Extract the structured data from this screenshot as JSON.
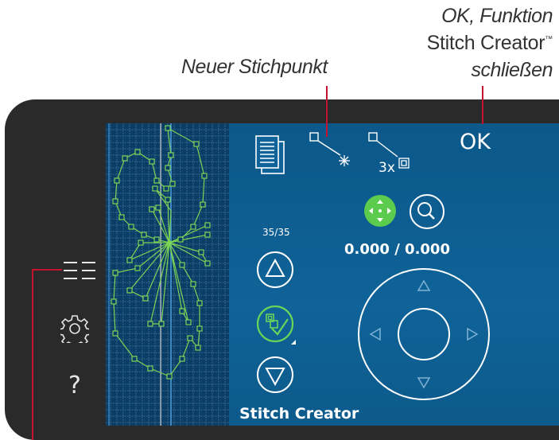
{
  "callouts": {
    "new_point": "Neuer Stichpunkt",
    "ok_line1": "OK, Funktion",
    "ok_line2": "Stitch Creator",
    "ok_line2_mark": "™",
    "ok_line3": "schließen"
  },
  "sidebar": {
    "items": [
      {
        "icon": "menu-list-icon",
        "glyph": "☰☰"
      },
      {
        "icon": "settings-gear-icon"
      },
      {
        "icon": "help-icon",
        "glyph": "?"
      }
    ]
  },
  "toolbar": {
    "ok_label": "OK",
    "triple_label": "3x"
  },
  "panel": {
    "counter": "35/35",
    "coordinates": "0.000 / 0.000",
    "title": "Stitch Creator"
  },
  "colors": {
    "screen_blue": "#0f6398",
    "grid_blue": "#0a3f66",
    "stitch_green": "#7cd454",
    "selected_green": "#4fb947",
    "leader_red": "#c4122f",
    "device_dark": "#2a2a2a"
  }
}
